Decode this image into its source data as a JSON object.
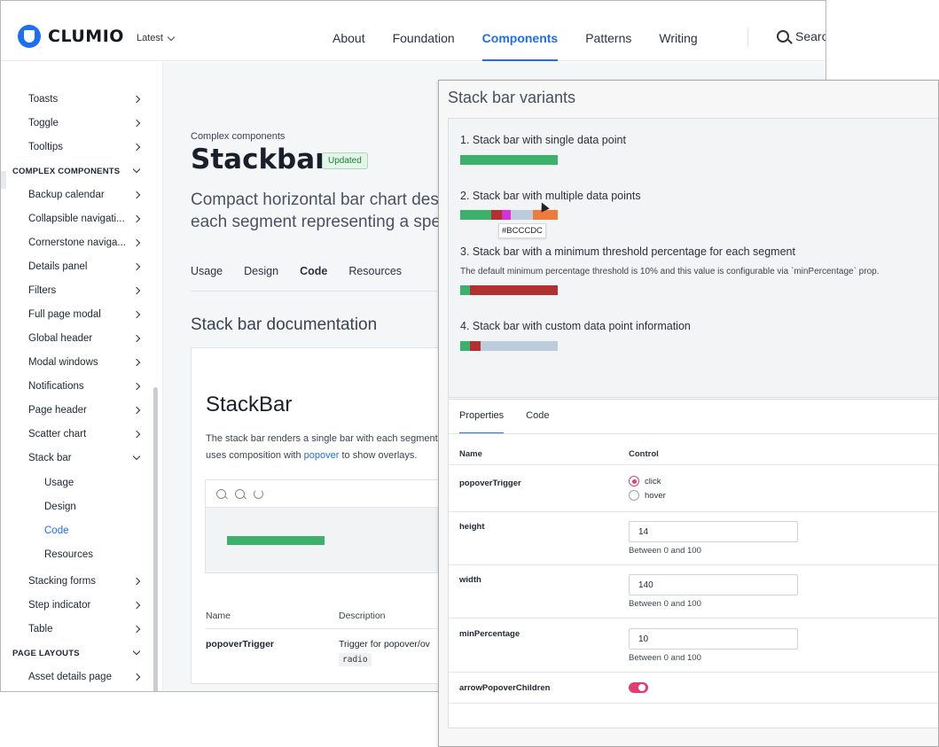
{
  "header": {
    "logo_text": "CLUMIO",
    "version": "Latest",
    "nav": [
      "About",
      "Foundation",
      "Components",
      "Patterns",
      "Writing"
    ],
    "active_nav": "Components",
    "search_label": "Searc"
  },
  "sidebar": {
    "items": [
      {
        "label": "Toasts",
        "type": "item"
      },
      {
        "label": "Toggle",
        "type": "item"
      },
      {
        "label": "Tooltips",
        "type": "item"
      },
      {
        "label": "COMPLEX COMPONENTS",
        "type": "section"
      },
      {
        "label": "Backup calendar",
        "type": "item"
      },
      {
        "label": "Collapsible navigati...",
        "type": "item"
      },
      {
        "label": "Cornerstone naviga...",
        "type": "item"
      },
      {
        "label": "Details panel",
        "type": "item"
      },
      {
        "label": "Filters",
        "type": "item"
      },
      {
        "label": "Full page modal",
        "type": "item"
      },
      {
        "label": "Global header",
        "type": "item"
      },
      {
        "label": "Modal windows",
        "type": "item"
      },
      {
        "label": "Notifications",
        "type": "item"
      },
      {
        "label": "Page header",
        "type": "item"
      },
      {
        "label": "Scatter chart",
        "type": "item"
      },
      {
        "label": "Stack bar",
        "type": "item-open"
      },
      {
        "label": "Usage",
        "type": "sub"
      },
      {
        "label": "Design",
        "type": "sub"
      },
      {
        "label": "Code",
        "type": "sub-active"
      },
      {
        "label": "Resources",
        "type": "sub"
      },
      {
        "label": "Stacking forms",
        "type": "item"
      },
      {
        "label": "Step indicator",
        "type": "item"
      },
      {
        "label": "Table",
        "type": "item"
      },
      {
        "label": "PAGE LAYOUTS",
        "type": "section"
      },
      {
        "label": "Asset details page",
        "type": "item"
      }
    ]
  },
  "page": {
    "breadcrumb": "Complex components",
    "title": "Stackbar",
    "badge": "Updated",
    "lead": "Compact horizontal bar chart des\neach segment representing a spe",
    "tabs": [
      "Usage",
      "Design",
      "Code",
      "Resources"
    ],
    "active_tab": "Code",
    "doc_title": "Stack bar documentation",
    "card_title": "StackBar",
    "card_text_1": "The stack bar renders a single bar with each segments",
    "card_text_2": "uses composition with ",
    "card_link": "popover",
    "card_text_3": " to show overlays.",
    "table": {
      "headers": [
        "Name",
        "Description"
      ],
      "rows": [
        {
          "name": "popoverTrigger",
          "description": "Trigger for popover/ov",
          "type": "radio"
        }
      ]
    }
  },
  "variants": {
    "title": "Stack bar variants",
    "items": [
      {
        "label": "1. Stack bar with single data point"
      },
      {
        "label": "2. Stack bar with multiple data points",
        "tooltip": "#BCCCDC"
      },
      {
        "label": "3. Stack bar with a minimum threshold percentage for each segment",
        "note": "The default minimum percentage threshold is 10% and this value is configurable via `minPercentage` prop."
      },
      {
        "label": "4. Stack bar with custom data point information"
      }
    ],
    "colors": {
      "green": "#3bb16b",
      "red": "#b23030",
      "magenta": "#d630d6",
      "grey": "#bcccdc",
      "orange": "#f07a3a"
    }
  },
  "properties": {
    "tabs": [
      "Properties",
      "Code"
    ],
    "active_tab": "Properties",
    "headers": [
      "Name",
      "Control"
    ],
    "popover_trigger": {
      "name": "popoverTrigger",
      "options": [
        "click",
        "hover"
      ],
      "selected": "click"
    },
    "height": {
      "name": "height",
      "value": "14",
      "hint": "Between 0 and 100"
    },
    "width": {
      "name": "width",
      "value": "140",
      "hint": "Between 0 and 100"
    },
    "min_percentage": {
      "name": "minPercentage",
      "value": "10",
      "hint": "Between 0 and 100"
    },
    "arrow_popover": {
      "name": "arrowPopoverChildren",
      "on": true
    }
  }
}
